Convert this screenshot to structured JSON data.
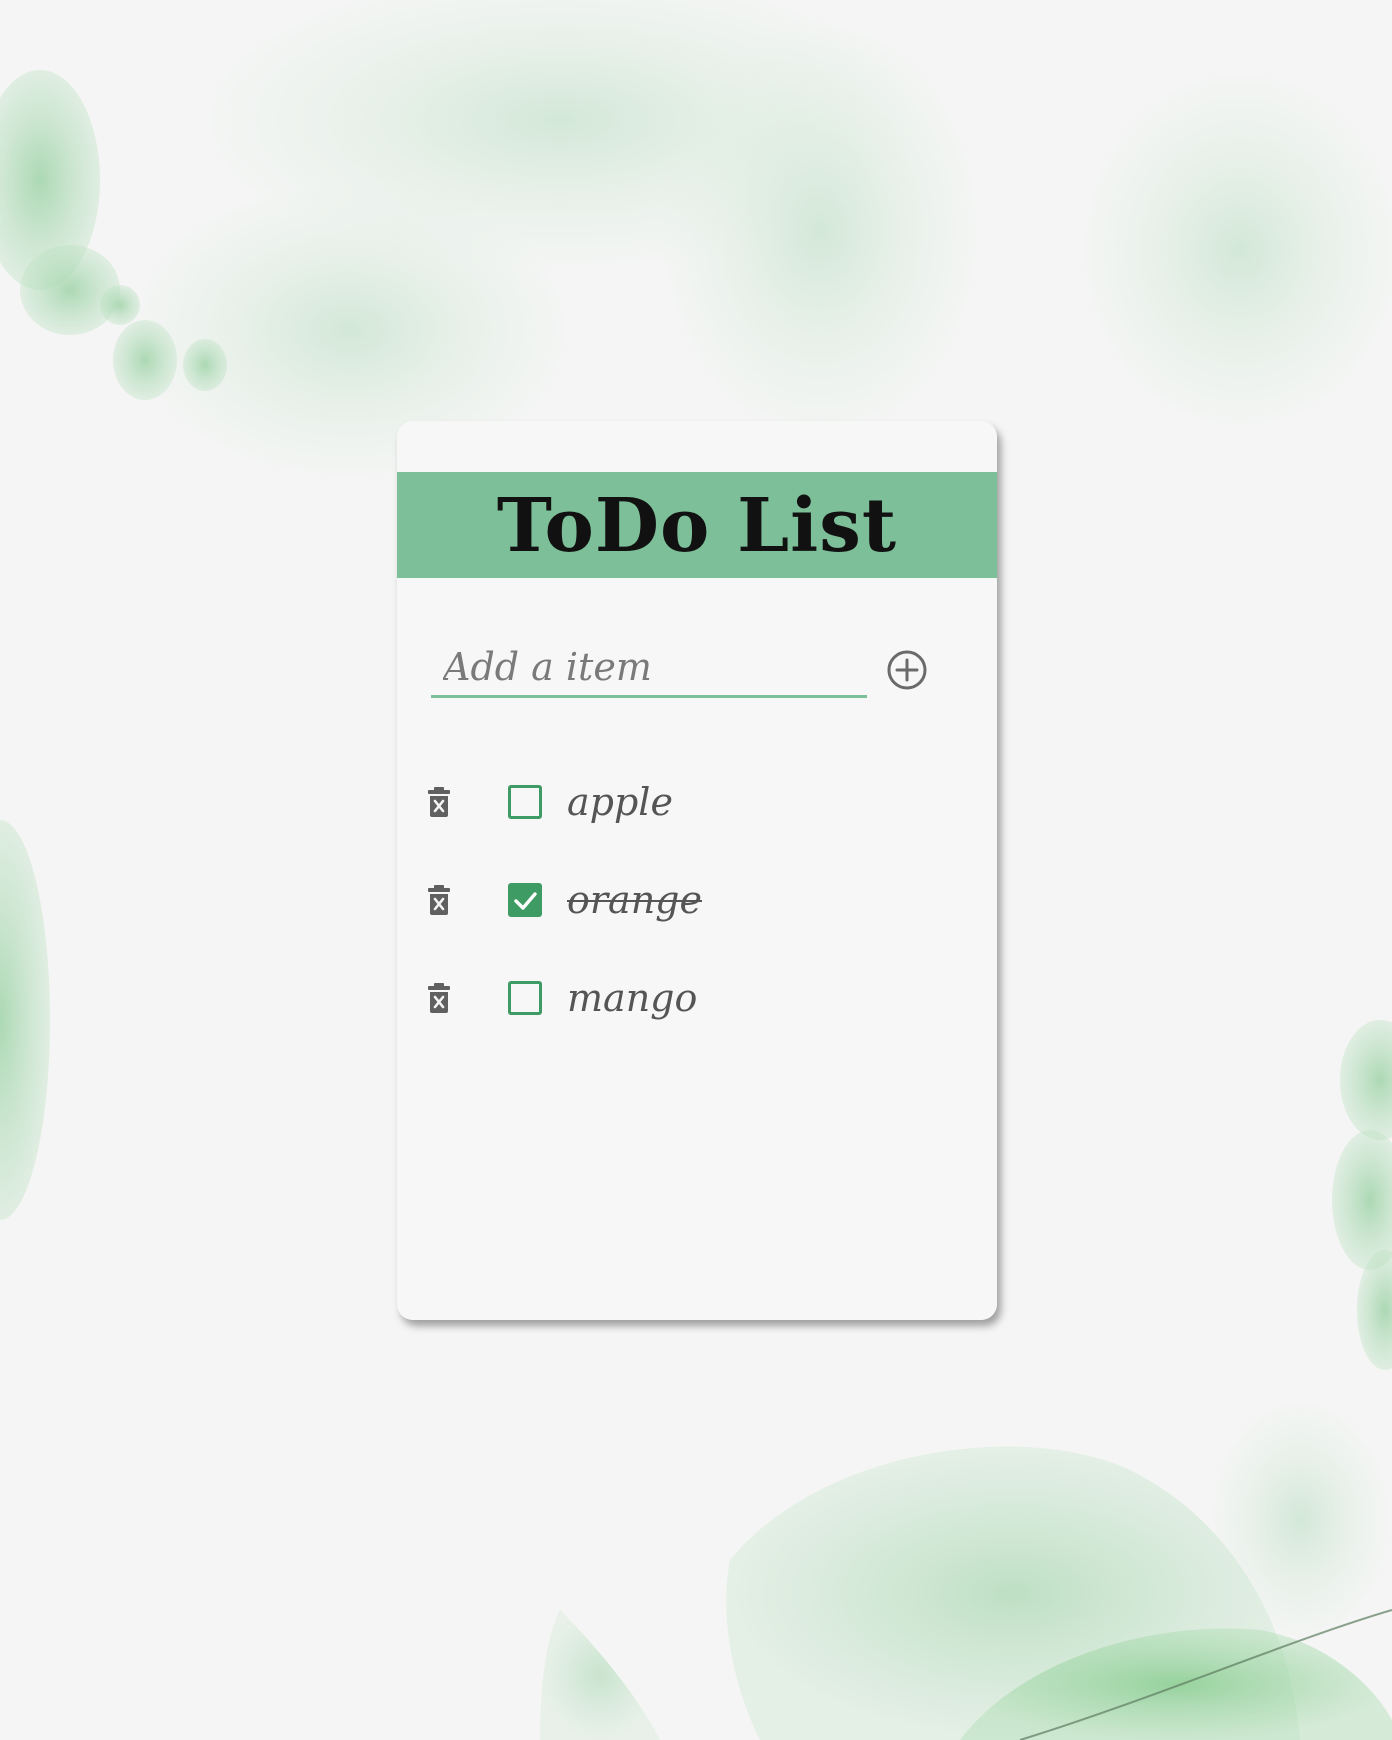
{
  "header": {
    "title": "ToDo List"
  },
  "add": {
    "placeholder": "Add a item",
    "button_icon": "plus-circle-icon"
  },
  "items": [
    {
      "text": "apple",
      "done": false
    },
    {
      "text": "orange",
      "done": true
    },
    {
      "text": "mango",
      "done": false
    }
  ],
  "colors": {
    "accent": "#7dbf98",
    "checkbox": "#3d9b63",
    "text": "#555555",
    "background": "#f4f5f4"
  }
}
